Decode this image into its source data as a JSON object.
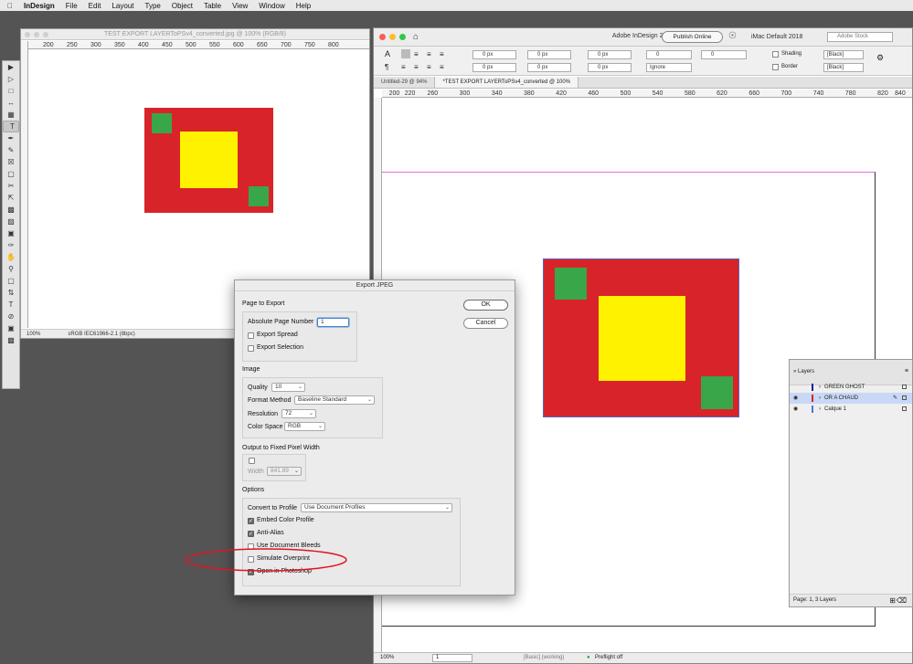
{
  "menubar": {
    "app": "InDesign",
    "items": [
      "File",
      "Edit",
      "Layout",
      "Type",
      "Object",
      "Table",
      "View",
      "Window",
      "Help"
    ]
  },
  "left_window": {
    "title": "TEST EXPORT LAYERToPSv4_converted.jpg @ 100% (RGB/8)",
    "ruler_ticks": [
      "200",
      "250",
      "300",
      "350",
      "400",
      "450",
      "500",
      "550",
      "600",
      "650",
      "700",
      "750",
      "800"
    ],
    "zoom": "100%",
    "profile": "sRGB IEC61966-2.1 (8bpc)"
  },
  "right_window": {
    "title": "Adobe InDesign 2020",
    "publish_label": "Publish Online",
    "workspace": "iMac Default 2018",
    "stock_placeholder": "Adobe Stock",
    "fields": {
      "px1": "0 px",
      "px2": "0 px",
      "px3": "0 px",
      "px4": "0 px",
      "px5": "0 px",
      "px6": "0 px",
      "zero1": "0",
      "zero2": "0",
      "ignore": "Ignore",
      "black1": "[Black]",
      "black2": "[Black]"
    },
    "shading_label": "Shading",
    "border_label": "Border",
    "tabs": [
      "Untitled-29 @ 94%",
      "*TEST EXPORT LAYERToPSv4_converted @ 100%"
    ],
    "ruler_ticks": [
      "200",
      "220",
      "260",
      "300",
      "340",
      "380",
      "420",
      "460",
      "500",
      "540",
      "580",
      "620",
      "660",
      "700",
      "740",
      "780",
      "820",
      "840"
    ],
    "status": {
      "zoom": "100%",
      "page": "1",
      "style": "[Basic] (working)",
      "preflight": "Preflight off"
    }
  },
  "dialog": {
    "title": "Export JPEG",
    "ok": "OK",
    "cancel": "Cancel",
    "page_to_export": "Page to Export",
    "absolute_page_number_label": "Absolute Page Number",
    "absolute_page_number_value": "1",
    "export_spread": "Export Spread",
    "export_selection": "Export Selection",
    "image": "Image",
    "quality_label": "Quality",
    "quality_value": "10",
    "format_method_label": "Format Method",
    "format_method_value": "Baseline Standard",
    "resolution_label": "Resolution",
    "resolution_value": "72",
    "color_space_label": "Color Space",
    "color_space_value": "RGB",
    "fixed_width": "Output to Fixed Pixel Width",
    "width_label": "Width",
    "width_value": "841.89",
    "options": "Options",
    "convert_label": "Convert to Profile",
    "convert_value": "Use Document Profiles",
    "embed_profile": "Embed Color Profile",
    "anti_alias": "Anti-Alias",
    "use_bleeds": "Use Document Bleeds",
    "simulate_overprint": "Simulate Overprint",
    "open_photoshop": "Open in Photoshop"
  },
  "layers": {
    "title": "Layers",
    "items": [
      {
        "name": "GREEN GHOST",
        "color": "#1e1e96"
      },
      {
        "name": "OR A CHAUD",
        "color": "#d8232a"
      },
      {
        "name": "Calque 1",
        "color": "#4a78d8"
      }
    ],
    "status": "Page: 1, 3 Layers"
  },
  "colors": {
    "red": "#d8232a",
    "yellow": "#fff200",
    "green": "#3aa64a",
    "annotation": "#e0141e"
  }
}
